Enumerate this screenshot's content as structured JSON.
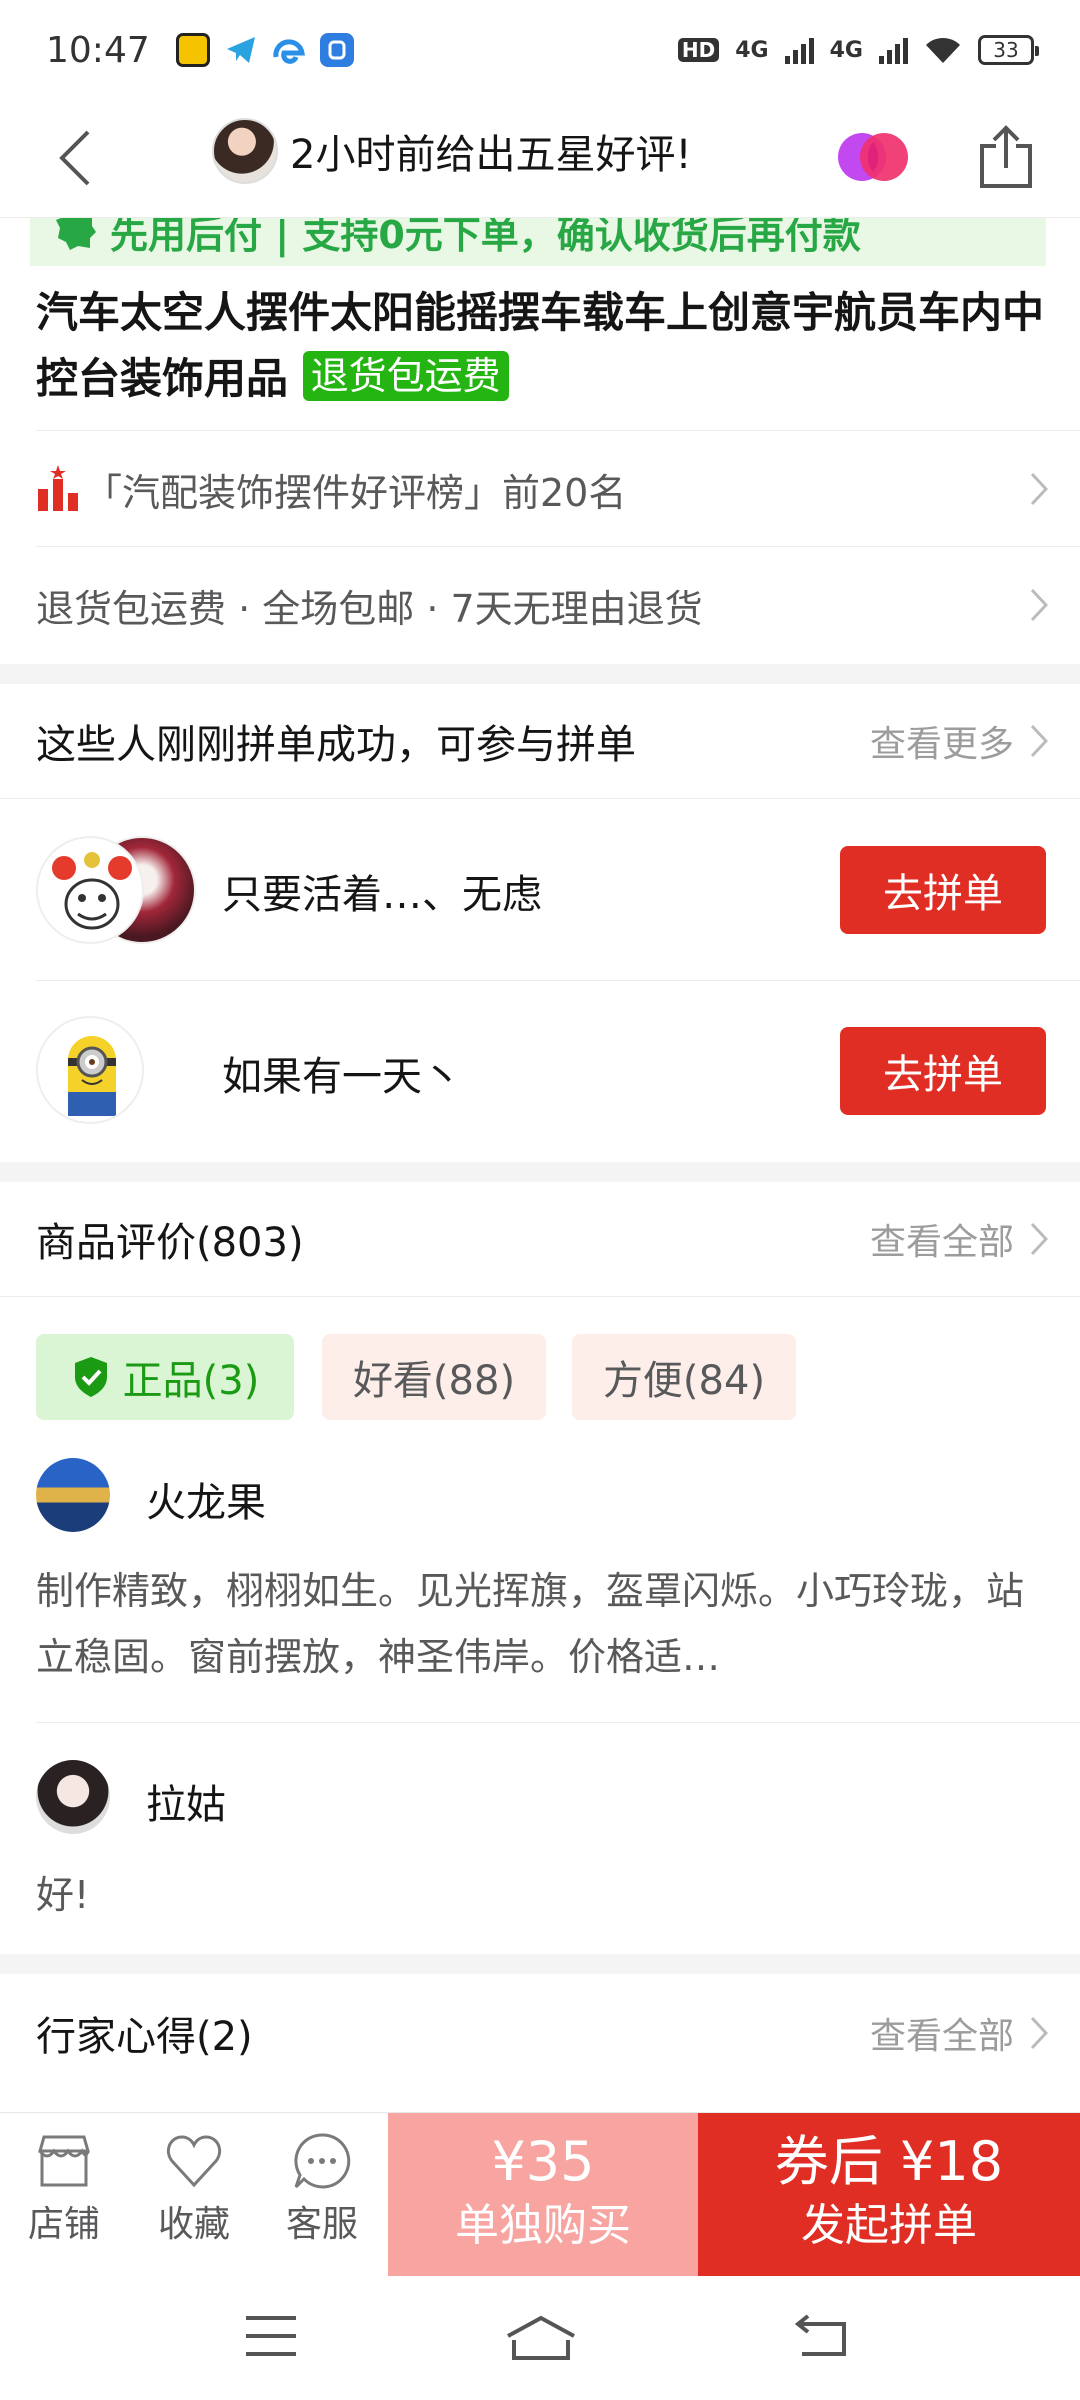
{
  "status_bar": {
    "time": "10:47",
    "hd": "HD",
    "net1": "4G",
    "net2": "4G",
    "battery": "33"
  },
  "nav": {
    "title": "2小时前给出五星好评!"
  },
  "banner": {
    "text": "先用后付 | 支持0元下单，确认收货后再付款"
  },
  "product": {
    "title": "汽车太空人摆件太阳能摇摆车载车上创意宇航员车内中控台装饰用品",
    "tag": "退货包运费"
  },
  "ranking": {
    "text": "「汽配装饰摆件好评榜」前20名"
  },
  "services": {
    "text": "退货包运费 · 全场包邮 · 7天无理由退货"
  },
  "group_buy": {
    "title": "这些人刚刚拼单成功，可参与拼单",
    "more": "查看更多",
    "groups": [
      {
        "name": "只要活着…、无虑",
        "button": "去拼单"
      },
      {
        "name": "如果有一天丶",
        "button": "去拼单"
      }
    ]
  },
  "reviews": {
    "title": "商品评价(803)",
    "more": "查看全部",
    "tags": [
      "正品(3)",
      "好看(88)",
      "方便(84)"
    ],
    "items": [
      {
        "name": "火龙果",
        "text": "制作精致，栩栩如生。见光挥旗，盔罩闪烁。小巧玲珑，站立稳固。窗前摆放，神圣伟岸。价格适…"
      },
      {
        "name": "拉姑",
        "text": "好!"
      }
    ]
  },
  "insights": {
    "title": "行家心得(2)",
    "more": "查看全部"
  },
  "bottom_bar": {
    "store": "店铺",
    "favorite": "收藏",
    "service": "客服",
    "alone_price": "¥35",
    "alone_label": "单独购买",
    "group_price": "券后 ¥18",
    "group_label": "发起拼单"
  },
  "colors": {
    "brand_red": "#e02e24",
    "light_red": "#f8a4a0",
    "green": "#25b513"
  }
}
